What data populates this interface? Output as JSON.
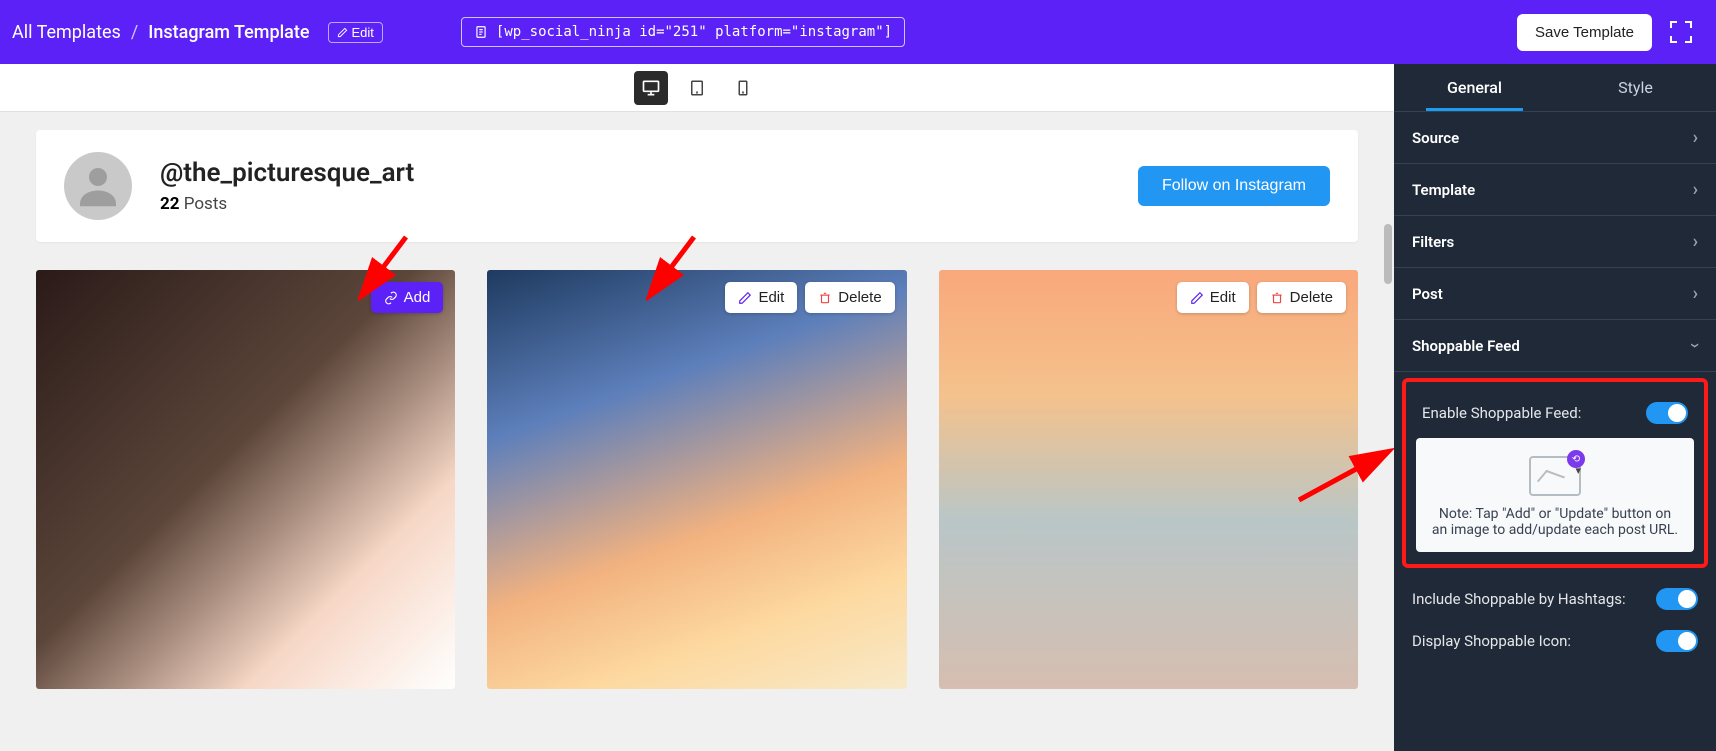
{
  "breadcrumb": {
    "parent": "All Templates",
    "current": "Instagram Template",
    "edit_label": "Edit"
  },
  "shortcode": "[wp_social_ninja id=\"251\" platform=\"instagram\"]",
  "save_label": "Save Template",
  "profile": {
    "handle": "@the_picturesque_art",
    "post_count": "22",
    "posts_word": "Posts",
    "follow_label": "Follow on Instagram"
  },
  "actions": {
    "add": "Add",
    "edit": "Edit",
    "delete": "Delete"
  },
  "sidebar": {
    "tabs": {
      "general": "General",
      "style": "Style"
    },
    "sections": {
      "source": "Source",
      "template": "Template",
      "filters": "Filters",
      "post": "Post",
      "shoppable": "Shoppable Feed"
    },
    "enable_shoppable_label": "Enable Shoppable Feed:",
    "note": "Note: Tap \"Add\" or \"Update\" button on an image to add/update each post URL.",
    "include_hashtags_label": "Include Shoppable by Hashtags:",
    "display_icon_label": "Display Shoppable Icon:"
  }
}
